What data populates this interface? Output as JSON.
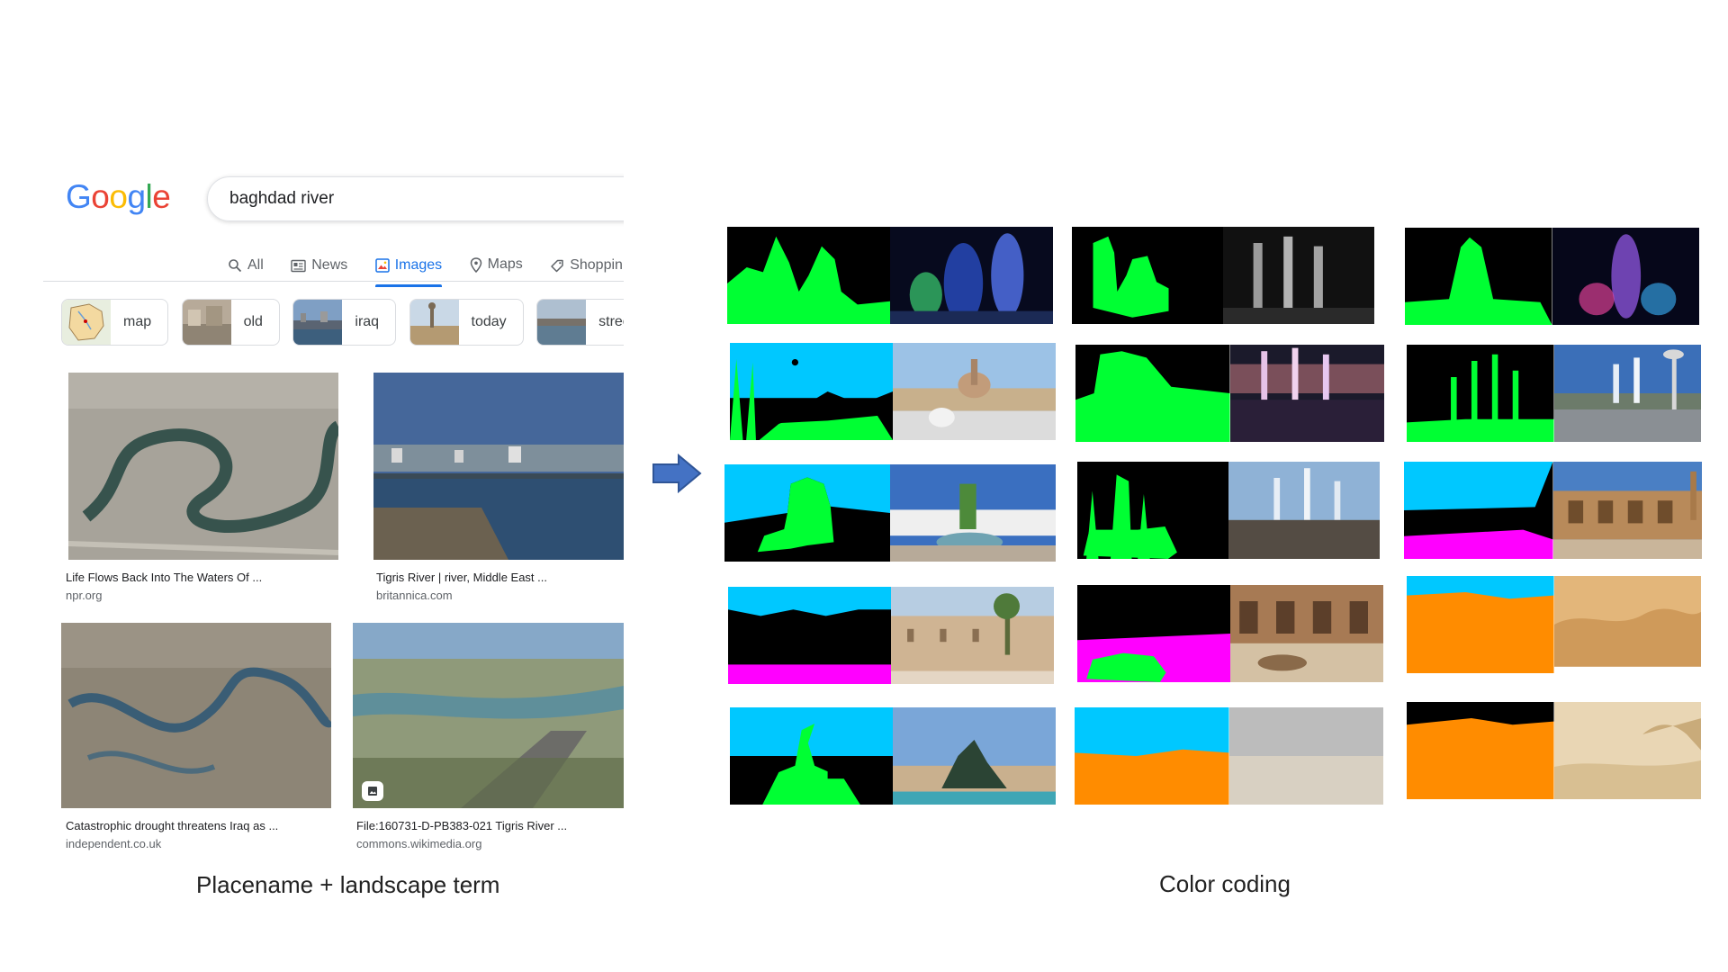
{
  "search": {
    "logo_letters": [
      {
        "char": "G",
        "color": "#4285F4"
      },
      {
        "char": "o",
        "color": "#EA4335"
      },
      {
        "char": "o",
        "color": "#FBBC05"
      },
      {
        "char": "g",
        "color": "#4285F4"
      },
      {
        "char": "l",
        "color": "#34A853"
      },
      {
        "char": "e",
        "color": "#EA4335"
      }
    ],
    "query": "baghdad river",
    "tabs": [
      {
        "label": "All",
        "icon": "search-icon"
      },
      {
        "label": "News",
        "icon": "news-icon"
      },
      {
        "label": "Images",
        "icon": "image-icon",
        "active": true
      },
      {
        "label": "Maps",
        "icon": "map-pin-icon"
      },
      {
        "label": "Shoppin",
        "icon": "tag-icon"
      }
    ],
    "chips": [
      {
        "label": "map"
      },
      {
        "label": "old"
      },
      {
        "label": "iraq"
      },
      {
        "label": "today"
      },
      {
        "label": "street"
      }
    ],
    "results": [
      {
        "title": "Life Flows Back Into The Waters Of ...",
        "site": "npr.org"
      },
      {
        "title": "Tigris River | river, Middle East ...",
        "site": "britannica.com"
      },
      {
        "title": "Catastrophic drought threatens Iraq as ...",
        "site": "independent.co.uk"
      },
      {
        "title": "File:160731-D-PB383-021 Tigris River ...",
        "site": "commons.wikimedia.org"
      }
    ],
    "accent_color": "#1a73e8"
  },
  "captions": {
    "left": "Placename + landscape term",
    "right": "Color coding"
  },
  "legend_colors": {
    "sky": "#00C8FF",
    "object": "#00FF33",
    "ground": "#FF00FF",
    "sand": "#FF8C00",
    "background": "#000000"
  }
}
